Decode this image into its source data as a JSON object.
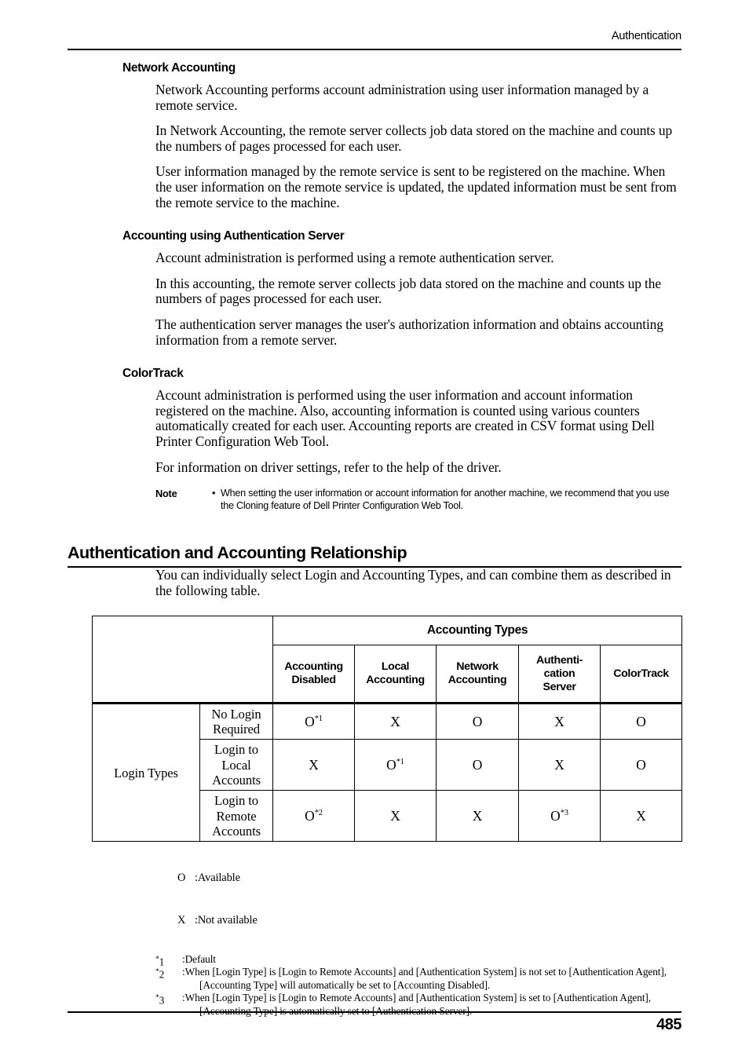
{
  "header": {
    "running_title": "Authentication"
  },
  "sections": [
    {
      "heading": "Network Accounting",
      "paragraphs": [
        "Network Accounting performs account administration using user information managed by a remote service.",
        "In Network Accounting, the remote server collects job data stored on the machine and counts up the numbers of pages processed for each user.",
        "User information managed by the remote service is sent to be registered on the machine. When the user information on the remote service is updated, the updated information must be sent from the remote service to the machine."
      ]
    },
    {
      "heading": "Accounting using Authentication Server",
      "paragraphs": [
        "Account administration is performed using a remote authentication server.",
        "In this accounting, the remote server collects job data stored on the machine and counts up the numbers of pages processed for each user.",
        "The authentication server manages the user's authorization information and obtains accounting information from a remote server."
      ]
    },
    {
      "heading": "ColorTrack",
      "paragraphs": [
        "Account administration is performed using the user information and account information registered on the machine. Also, accounting information is counted using various counters automatically created for each user. Accounting reports are created in CSV format using Dell Printer Configuration Web Tool.",
        "For information on driver settings, refer to the help of the driver."
      ]
    }
  ],
  "note": {
    "label": "Note",
    "bullet": "•",
    "text": "When setting the user information or account information for another machine, we recommend that you use the Cloning feature of Dell Printer Configuration Web Tool."
  },
  "section_heading": "Authentication and Accounting Relationship",
  "section_intro": "You can individually select Login and Accounting Types, and can combine them as described in the following table.",
  "table": {
    "group_header": "Accounting Types",
    "row_group_label": "Login Types",
    "column_headers": [
      "Accounting Disabled",
      "Local Accounting",
      "Network Accounting",
      "Authenti- cation Server",
      "ColorTrack"
    ],
    "column_headers_lines": [
      [
        "Accounting",
        "Disabled"
      ],
      [
        "Local",
        "Accounting"
      ],
      [
        "Network",
        "Accounting"
      ],
      [
        "Authenti-",
        "cation",
        "Server"
      ],
      [
        "ColorTrack"
      ]
    ],
    "rows": [
      {
        "label_lines": [
          "No Login",
          "Required"
        ],
        "cells": [
          {
            "value": "O",
            "note": "*1"
          },
          {
            "value": "X",
            "note": ""
          },
          {
            "value": "O",
            "note": ""
          },
          {
            "value": "X",
            "note": ""
          },
          {
            "value": "O",
            "note": ""
          }
        ]
      },
      {
        "label_lines": [
          "Login to",
          "Local",
          "Accounts"
        ],
        "cells": [
          {
            "value": "X",
            "note": ""
          },
          {
            "value": "O",
            "note": "*1"
          },
          {
            "value": "O",
            "note": ""
          },
          {
            "value": "X",
            "note": ""
          },
          {
            "value": "O",
            "note": ""
          }
        ]
      },
      {
        "label_lines": [
          "Login to",
          "Remote",
          "Accounts"
        ],
        "cells": [
          {
            "value": "O",
            "note": "*2"
          },
          {
            "value": "X",
            "note": ""
          },
          {
            "value": "X",
            "note": ""
          },
          {
            "value": "O",
            "note": "*3"
          },
          {
            "value": "X",
            "note": ""
          }
        ]
      }
    ]
  },
  "legend": [
    {
      "symbol": "O",
      "text": ":Available"
    },
    {
      "symbol": "X",
      "text": ":Not available"
    }
  ],
  "footnotes": [
    {
      "mark": "1",
      "line1": ":Default",
      "line2": ""
    },
    {
      "mark": "2",
      "line1": ":When [Login Type] is [Login to Remote Accounts] and [Authentication System] is not set to [Authentication Agent],",
      "line2": "[Accounting Type] will automatically be set to [Accounting Disabled]."
    },
    {
      "mark": "3",
      "line1": ":When [Login Type] is [Login to Remote Accounts] and [Authentication System] is set to [Authentication Agent],",
      "line2": "[Accounting Type] is automatically set to [Authentication Server]."
    }
  ],
  "footer": {
    "page_number": "485"
  }
}
